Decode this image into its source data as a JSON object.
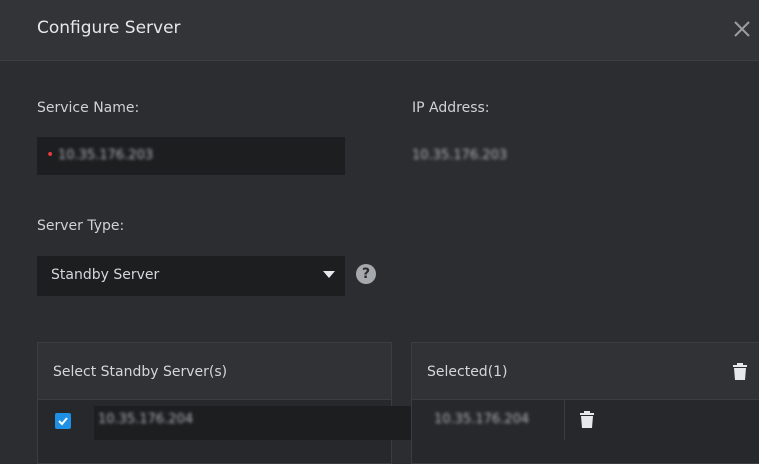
{
  "dialog": {
    "title": "Configure Server",
    "close_icon": "close-icon"
  },
  "form": {
    "service_name_label": "Service Name:",
    "service_name_value": "10.35.176.203",
    "ip_address_label": "IP Address:",
    "ip_address_value": "10.35.176.203",
    "server_type_label": "Server Type:",
    "server_type_value": "Standby Server",
    "required_marker": "•"
  },
  "select_panel": {
    "header": "Select Standby Server(s)",
    "items": [
      {
        "checked": true,
        "value": "10.35.176.204"
      }
    ]
  },
  "selected_panel": {
    "header": "Selected(1)",
    "items": [
      {
        "value": "10.35.176.204"
      }
    ]
  },
  "colors": {
    "background": "#2b2d30",
    "input_bg": "#1d1e20",
    "accent": "#1e90e6",
    "required": "#e23b3b"
  }
}
